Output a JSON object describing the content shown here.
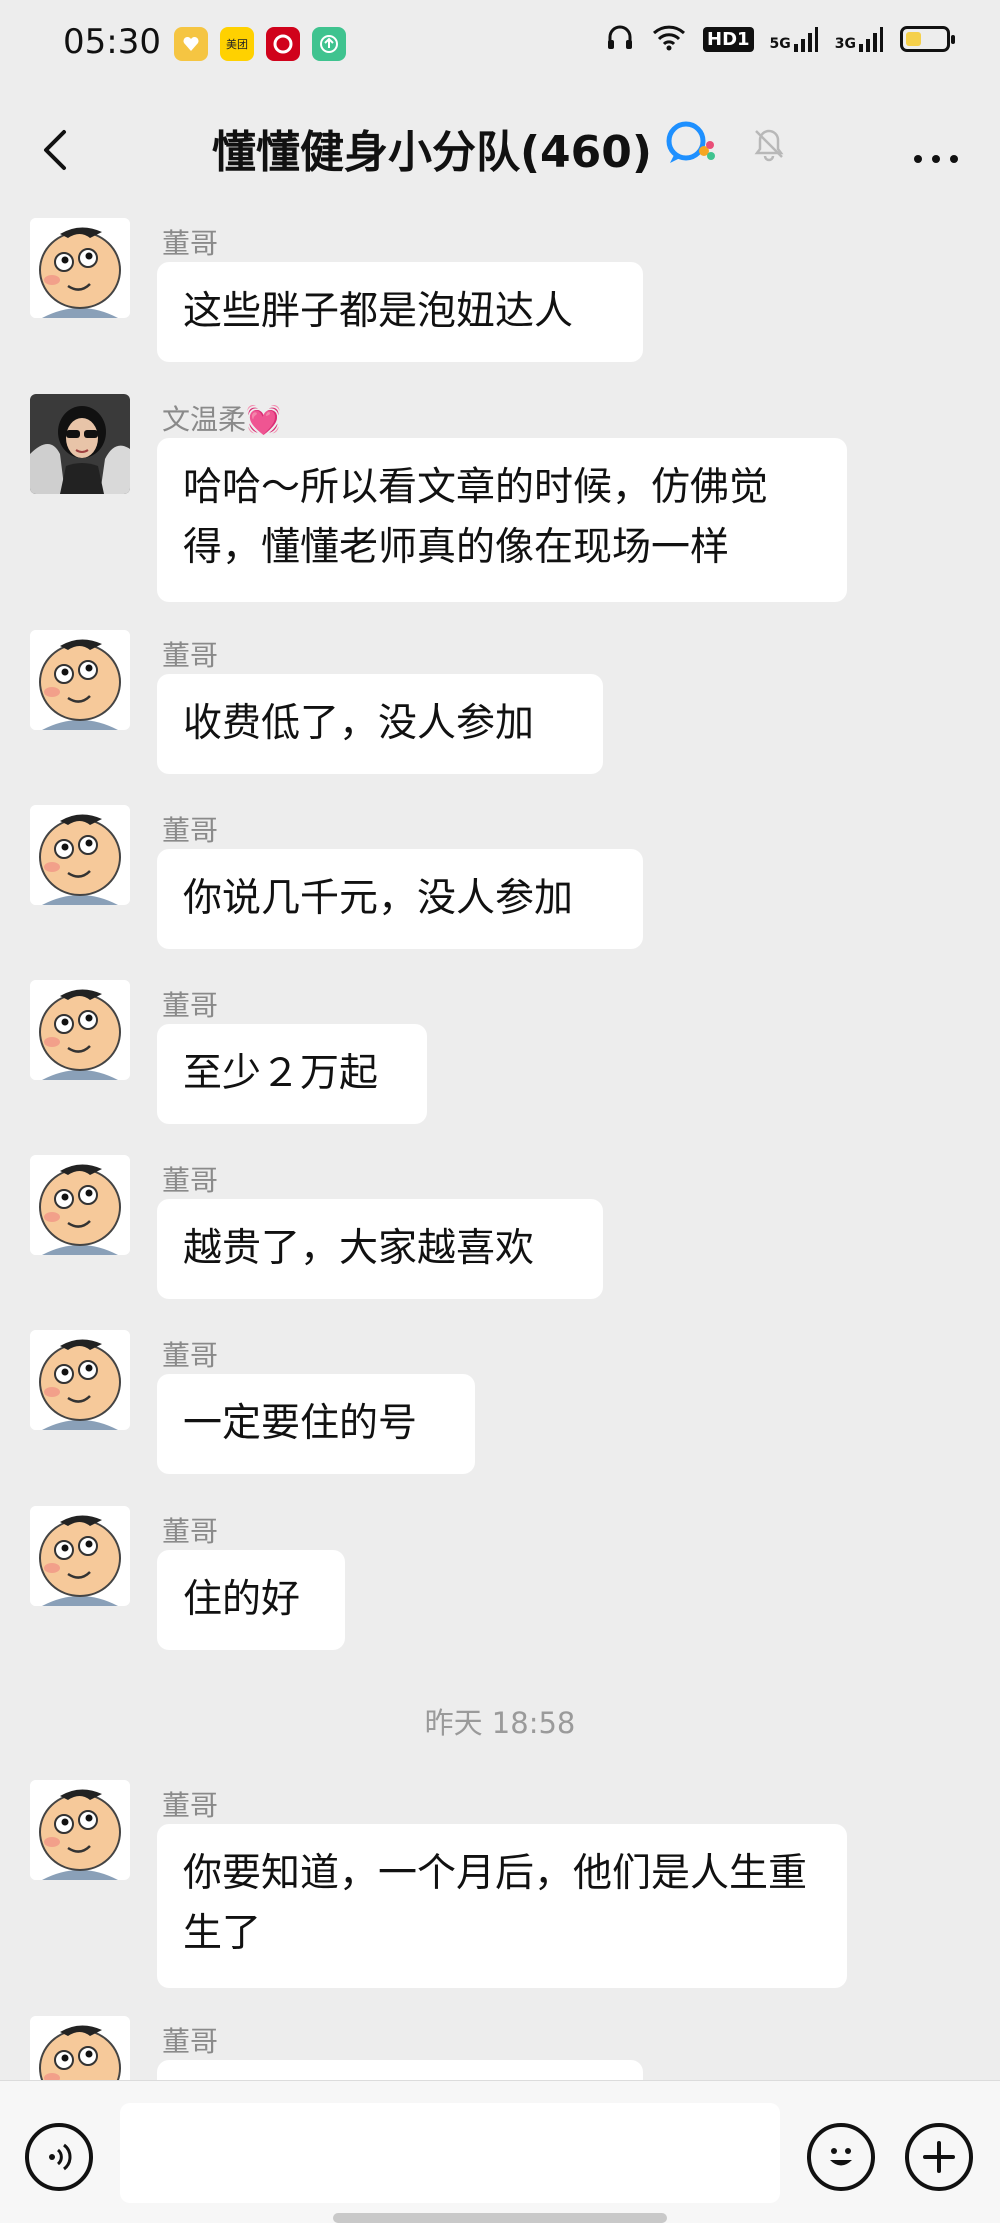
{
  "status_bar": {
    "time": "05:30",
    "app_icons": [
      {
        "name": "heart-app-icon",
        "label": "",
        "color": "#f5c542"
      },
      {
        "name": "meituan-app-icon",
        "label": "美团",
        "color": "#ffd100"
      },
      {
        "name": "cmb-bank-app-icon",
        "label": "",
        "color": "#d0021b"
      },
      {
        "name": "upload-app-icon",
        "label": "",
        "color": "#3fc38f"
      }
    ],
    "hd_label": "HD1",
    "net1": "5G",
    "net2": "3G",
    "battery_level": 0.4
  },
  "header": {
    "title": "懂懂健身小分队(460)"
  },
  "messages": [
    {
      "sender": "董哥",
      "avatar": "cartoon",
      "text": "这些胖子都是泡妞达人"
    },
    {
      "sender": "文温柔💓",
      "avatar": "photo",
      "text": "哈哈～所以看文章的时候，仿佛觉得，懂懂老师真的像在现场一样"
    },
    {
      "sender": "董哥",
      "avatar": "cartoon",
      "text": "收费低了，没人参加"
    },
    {
      "sender": "董哥",
      "avatar": "cartoon",
      "text": "你说几千元，没人参加"
    },
    {
      "sender": "董哥",
      "avatar": "cartoon",
      "text": "至少２万起"
    },
    {
      "sender": "董哥",
      "avatar": "cartoon",
      "text": "越贵了，大家越喜欢"
    },
    {
      "sender": "董哥",
      "avatar": "cartoon",
      "text": "一定要住的号"
    },
    {
      "sender": "董哥",
      "avatar": "cartoon",
      "text": "住的好"
    },
    {
      "sender": "董哥",
      "avatar": "cartoon",
      "text": "你要知道，一个月后，他们是人生重生了"
    },
    {
      "sender": "董哥",
      "avatar": "cartoon",
      "text": ""
    }
  ],
  "timestamp": "昨天 18:58",
  "input": {
    "placeholder": ""
  }
}
